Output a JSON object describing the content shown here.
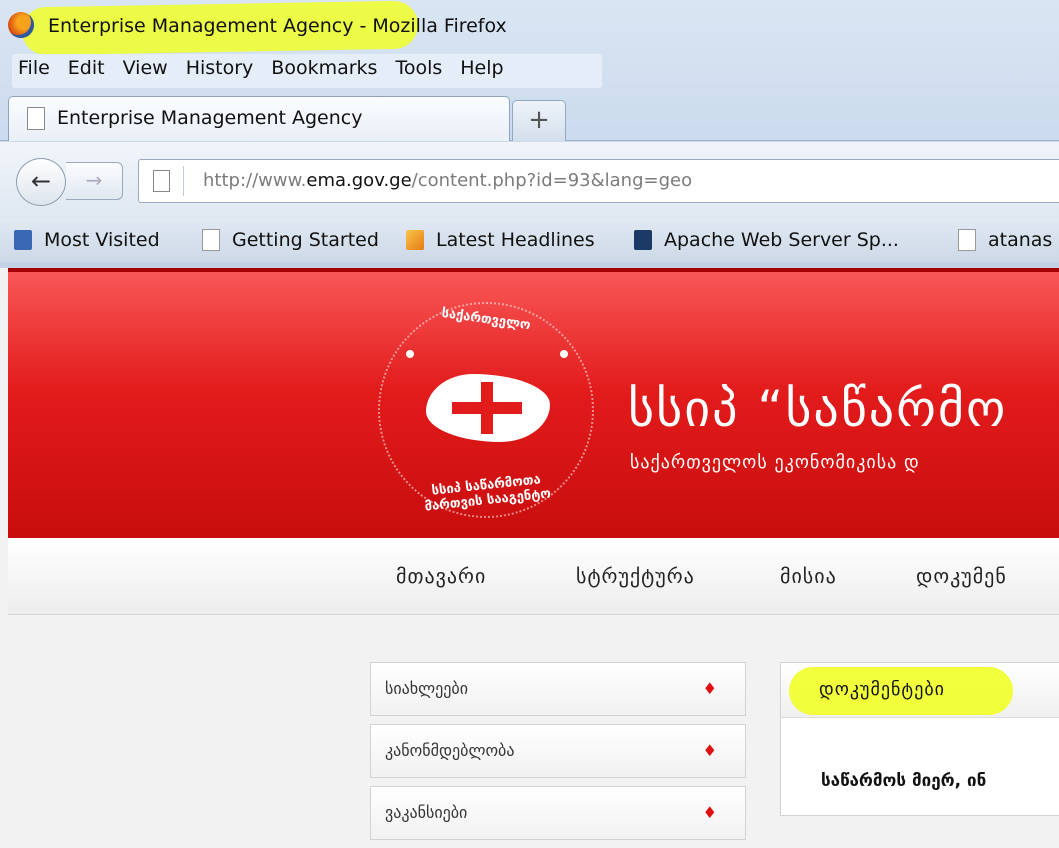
{
  "window": {
    "title": "Enterprise Management Agency - Mozilla Firefox"
  },
  "menu": [
    "File",
    "Edit",
    "View",
    "History",
    "Bookmarks",
    "Tools",
    "Help"
  ],
  "tab": {
    "label": "Enterprise Management Agency",
    "newtab_label": "+"
  },
  "nav": {
    "url_prefix": "http://www.",
    "url_domain": "ema.gov.ge",
    "url_suffix": "/content.php?id=93&lang=geo"
  },
  "bookmarks": [
    {
      "label": "Most Visited",
      "icon": "most-visited-icon"
    },
    {
      "label": "Getting Started",
      "icon": "page-icon"
    },
    {
      "label": "Latest Headlines",
      "icon": "rss-icon"
    },
    {
      "label": "Apache Web Server Sp...",
      "icon": "apache-icon"
    },
    {
      "label": "atanas",
      "icon": "page-icon"
    }
  ],
  "site": {
    "logo_top": "საქართველო",
    "logo_bottom": "სსიპ საწარმოთა მართვის სააგენტო",
    "title": "სსიპ “საწარმო",
    "subtitle": "საქართველოს ეკონომიკისა დ",
    "nav": [
      "მთავარი",
      "სტრუქტურა",
      "მისია",
      "დოკუმენ"
    ],
    "sidebar": [
      "სიახლეები",
      "კანონმდებლობა",
      "ვაკანსიები"
    ],
    "content_title": "დოკუმენტები",
    "content_text": "საწარმოს მიერ, ინ"
  },
  "colors": {
    "banner_red": "#e21b1b",
    "highlight": "#f0ff28",
    "chrome_blue": "#d9e5f3"
  }
}
